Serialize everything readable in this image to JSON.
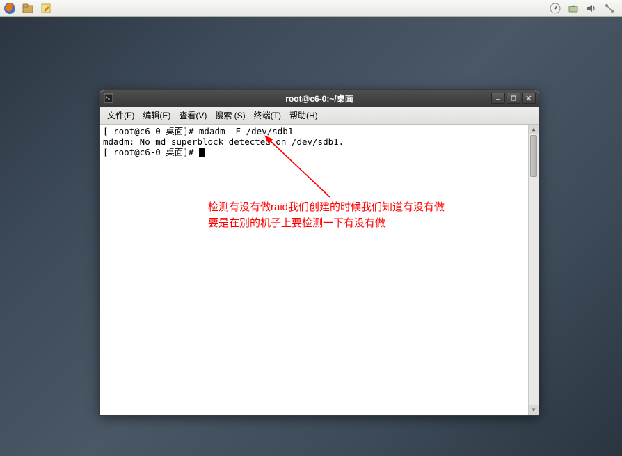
{
  "taskbar": {
    "left_icons": [
      "firefox-icon",
      "file-manager-icon",
      "notepad-icon"
    ],
    "right_icons": [
      "speedometer-icon",
      "update-icon",
      "volume-icon",
      "network-icon"
    ]
  },
  "window": {
    "title": "root@c6-0:~/桌面",
    "menubar": [
      {
        "label": "文件(F)"
      },
      {
        "label": "编辑(E)"
      },
      {
        "label": "查看(V)"
      },
      {
        "label": "搜索 (S)"
      },
      {
        "label": "终端(T)"
      },
      {
        "label": "帮助(H)"
      }
    ]
  },
  "terminal": {
    "lines": [
      "[ root@c6-0 桌面]# mdadm -E /dev/sdb1",
      "mdadm: No md superblock detected on /dev/sdb1.",
      "[ root@c6-0 桌面]# "
    ]
  },
  "annotation": {
    "line1": "检测有没有做raid我们创建的时候我们知道有没有做",
    "line2": "要是在别的机子上要检测一下有没有做"
  }
}
